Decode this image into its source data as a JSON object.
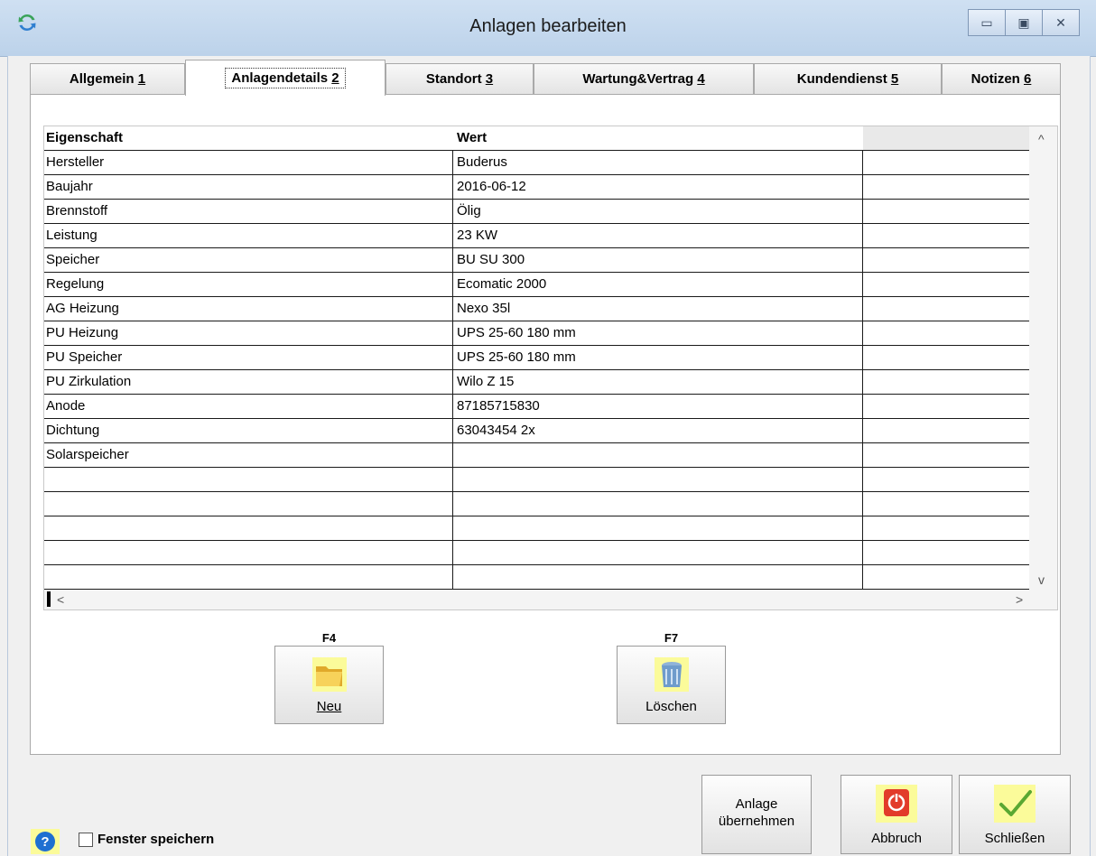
{
  "window": {
    "title": "Anlagen bearbeiten",
    "minimize_glyph": "▭",
    "maximize_glyph": "▣",
    "close_glyph": "✕"
  },
  "tabs": [
    {
      "label": "Allgemein",
      "key": "1"
    },
    {
      "label": "Anlagendetails",
      "key": "2"
    },
    {
      "label": "Standort",
      "key": "3"
    },
    {
      "label": "Wartung&Vertrag",
      "key": "4"
    },
    {
      "label": "Kundendienst",
      "key": "5"
    },
    {
      "label": "Notizen",
      "key": "6"
    }
  ],
  "active_tab": 1,
  "grid": {
    "headers": [
      "Eigenschaft",
      "Wert",
      ""
    ],
    "rows": [
      [
        "Hersteller",
        "Buderus"
      ],
      [
        "Baujahr",
        "2016-06-12"
      ],
      [
        "Brennstoff",
        "Ölig"
      ],
      [
        "Leistung",
        "23 KW"
      ],
      [
        "Speicher",
        "BU SU 300"
      ],
      [
        "Regelung",
        "Ecomatic 2000"
      ],
      [
        "AG Heizung",
        "Nexo 35l"
      ],
      [
        "PU Heizung",
        "UPS 25-60 180 mm"
      ],
      [
        "PU Speicher",
        "UPS 25-60 180 mm"
      ],
      [
        "PU Zirkulation",
        "Wilo Z 15"
      ],
      [
        "Anode",
        "87185715830"
      ],
      [
        "Dichtung",
        "63043454 2x"
      ],
      [
        "Solarspeicher",
        ""
      ],
      [
        "",
        ""
      ],
      [
        "",
        ""
      ],
      [
        "",
        ""
      ],
      [
        "",
        ""
      ],
      [
        "",
        ""
      ]
    ],
    "scroll_up": "^",
    "scroll_down": "v",
    "scroll_left": "<",
    "scroll_right": ">"
  },
  "actions": {
    "new": {
      "key": "F4",
      "label": "Neu",
      "icon": "folder-icon"
    },
    "delete": {
      "key": "F7",
      "label": "Löschen",
      "icon": "trash-icon"
    }
  },
  "footer": {
    "save_window_label": "Fenster speichern",
    "save_window_checked": false,
    "apply_line1": "Anlage",
    "apply_line2": "übernehmen",
    "cancel_label": "Abbruch",
    "close_label": "Schließen",
    "help_glyph": "?"
  },
  "colors": {
    "titlebar": "#c5d9ee",
    "icon_highlight": "#fbfb9a",
    "help_blue": "#1f6fd1",
    "cancel_red": "#e23b2a",
    "check_green": "#5aa832"
  }
}
